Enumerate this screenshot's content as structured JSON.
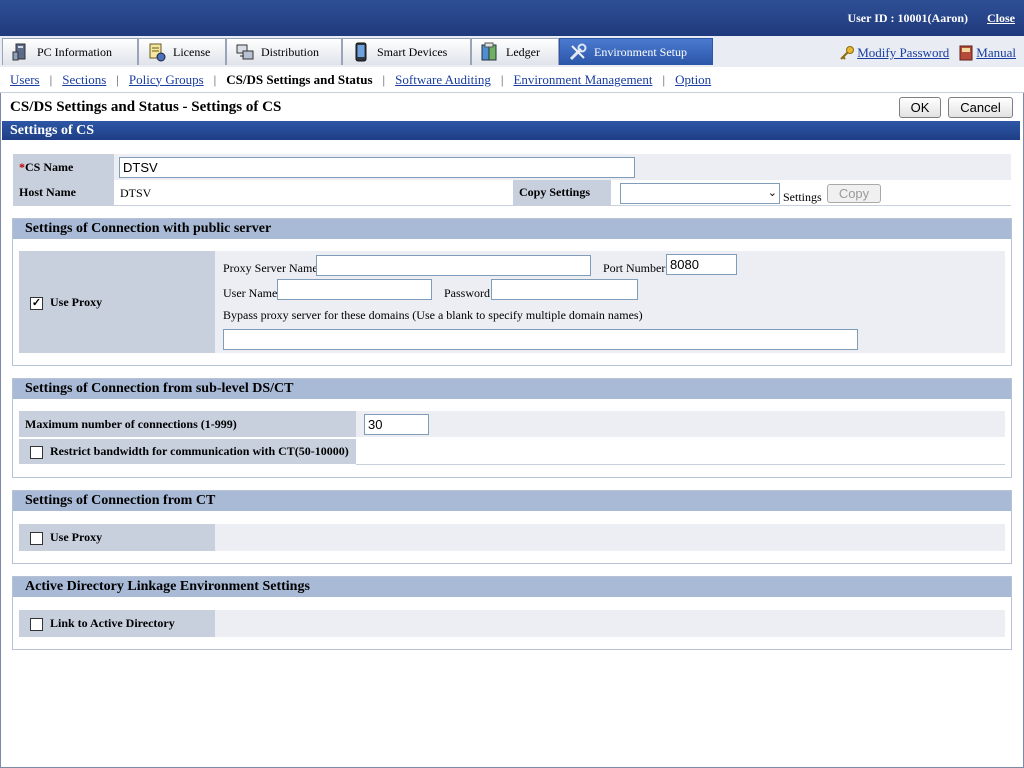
{
  "header": {
    "user_id": "User ID : 10001(Aaron)",
    "close_label": "Close"
  },
  "tabs": [
    {
      "label": "PC Information"
    },
    {
      "label": "License"
    },
    {
      "label": "Distribution"
    },
    {
      "label": "Smart Devices"
    },
    {
      "label": "Ledger"
    },
    {
      "label": "Environment Setup"
    }
  ],
  "top_links": {
    "modify_password": "Modify Password",
    "manual": "Manual"
  },
  "subnav": [
    {
      "label": "Users"
    },
    {
      "label": "Sections"
    },
    {
      "label": "Policy Groups"
    },
    {
      "label": "CS/DS Settings and Status"
    },
    {
      "label": "Software Auditing"
    },
    {
      "label": "Environment Management"
    },
    {
      "label": "Option"
    }
  ],
  "page": {
    "title": "CS/DS Settings and Status - Settings of CS",
    "ok_label": "OK",
    "cancel_label": "Cancel",
    "section_title": "Settings of CS"
  },
  "cs": {
    "required_mark": "*",
    "name_label": "CS Name",
    "name_value": "DTSV",
    "host_label": "Host Name",
    "host_value": "DTSV",
    "copy_settings_label": "Copy Settings",
    "copy_select_value": "",
    "settings_suffix": "Settings",
    "copy_button": "Copy"
  },
  "public_server": {
    "title": "Settings of Connection with public server",
    "use_proxy_label": "Use Proxy",
    "use_proxy_checked": true,
    "proxy_server_label": "Proxy Server Name",
    "proxy_server_value": "",
    "port_label": "Port Number",
    "port_value": "8080",
    "user_label": "User Name",
    "user_value": "",
    "password_label": "Password",
    "password_value": "",
    "bypass_label": "Bypass proxy server for these domains (Use a blank to specify multiple domain names)",
    "bypass_value": ""
  },
  "sublevel": {
    "title": "Settings of Connection from sub-level DS/CT",
    "max_conn_label": "Maximum number of connections (1-999)",
    "max_conn_value": "30",
    "restrict_label": "Restrict bandwidth for communication with CT(50-10000)",
    "restrict_checked": false
  },
  "from_ct": {
    "title": "Settings of Connection from CT",
    "use_proxy_label": "Use Proxy",
    "use_proxy_checked": false
  },
  "active_directory": {
    "title": "Active Directory Linkage Environment Settings",
    "link_label": "Link to Active Directory",
    "link_checked": false
  },
  "icons": {
    "tabs": [
      "pc-icon",
      "license-icon",
      "distribution-icon",
      "smart-device-icon",
      "ledger-icon",
      "tools-icon"
    ],
    "modify_password": "key-icon",
    "manual": "book-icon"
  },
  "colors": {
    "header_blue": "#1f3a7c",
    "active_tab": "#2b56a8",
    "link": "#1a3da0",
    "label_bg": "#c8d0de",
    "group_head": "#a9bad6"
  }
}
